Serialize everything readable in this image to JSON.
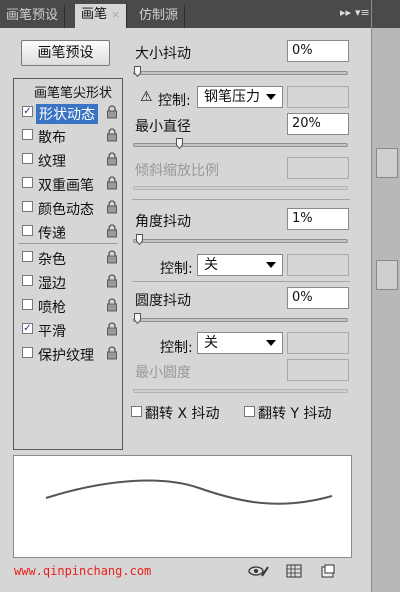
{
  "tabs": [
    {
      "label": "画笔预设",
      "active": false
    },
    {
      "label": "画笔",
      "active": true,
      "close": "×"
    },
    {
      "label": "仿制源",
      "active": false
    }
  ],
  "tab_controls": {
    "collapse": "▸▸",
    "menu": "▾≡"
  },
  "preset_button": "画笔预设",
  "brush_tip_header": "画笔笔尖形状",
  "options": [
    {
      "label": "形状动态",
      "checked": true,
      "selected": true
    },
    {
      "label": "散布",
      "checked": false
    },
    {
      "label": "纹理",
      "checked": false
    },
    {
      "label": "双重画笔",
      "checked": false
    },
    {
      "label": "颜色动态",
      "checked": false
    },
    {
      "label": "传递",
      "checked": false
    },
    {
      "label": "杂色",
      "checked": false
    },
    {
      "label": "湿边",
      "checked": false
    },
    {
      "label": "喷枪",
      "checked": false
    },
    {
      "label": "平滑",
      "checked": true
    },
    {
      "label": "保护纹理",
      "checked": false
    }
  ],
  "check_mark": "✓",
  "size_jitter": {
    "label": "大小抖动",
    "value": "0%",
    "slider_fraction": 0.0
  },
  "size_control": {
    "warning": "⚠",
    "label": "控制:",
    "value": "钢笔压力"
  },
  "min_diameter": {
    "label": "最小直径",
    "value": "20%",
    "slider_fraction": 0.2
  },
  "tilt_scale": {
    "label": "倾斜缩放比例"
  },
  "angle_jitter": {
    "label": "角度抖动",
    "value": "1%",
    "slider_fraction": 0.01
  },
  "angle_control": {
    "label": "控制:",
    "value": "关"
  },
  "roundness_jitter": {
    "label": "圆度抖动",
    "value": "0%",
    "slider_fraction": 0.0
  },
  "roundness_control": {
    "label": "控制:",
    "value": "关"
  },
  "min_roundness": {
    "label": "最小圆度"
  },
  "flip_x": {
    "label": "翻转 X 抖动",
    "checked": false
  },
  "flip_y": {
    "label": "翻转 Y 抖动",
    "checked": false
  },
  "watermark": "www.qinpinchang.com",
  "colors": {
    "selection": "#3a73c4",
    "watermark": "#e8201a",
    "tabbar": "#4a4a4a"
  }
}
